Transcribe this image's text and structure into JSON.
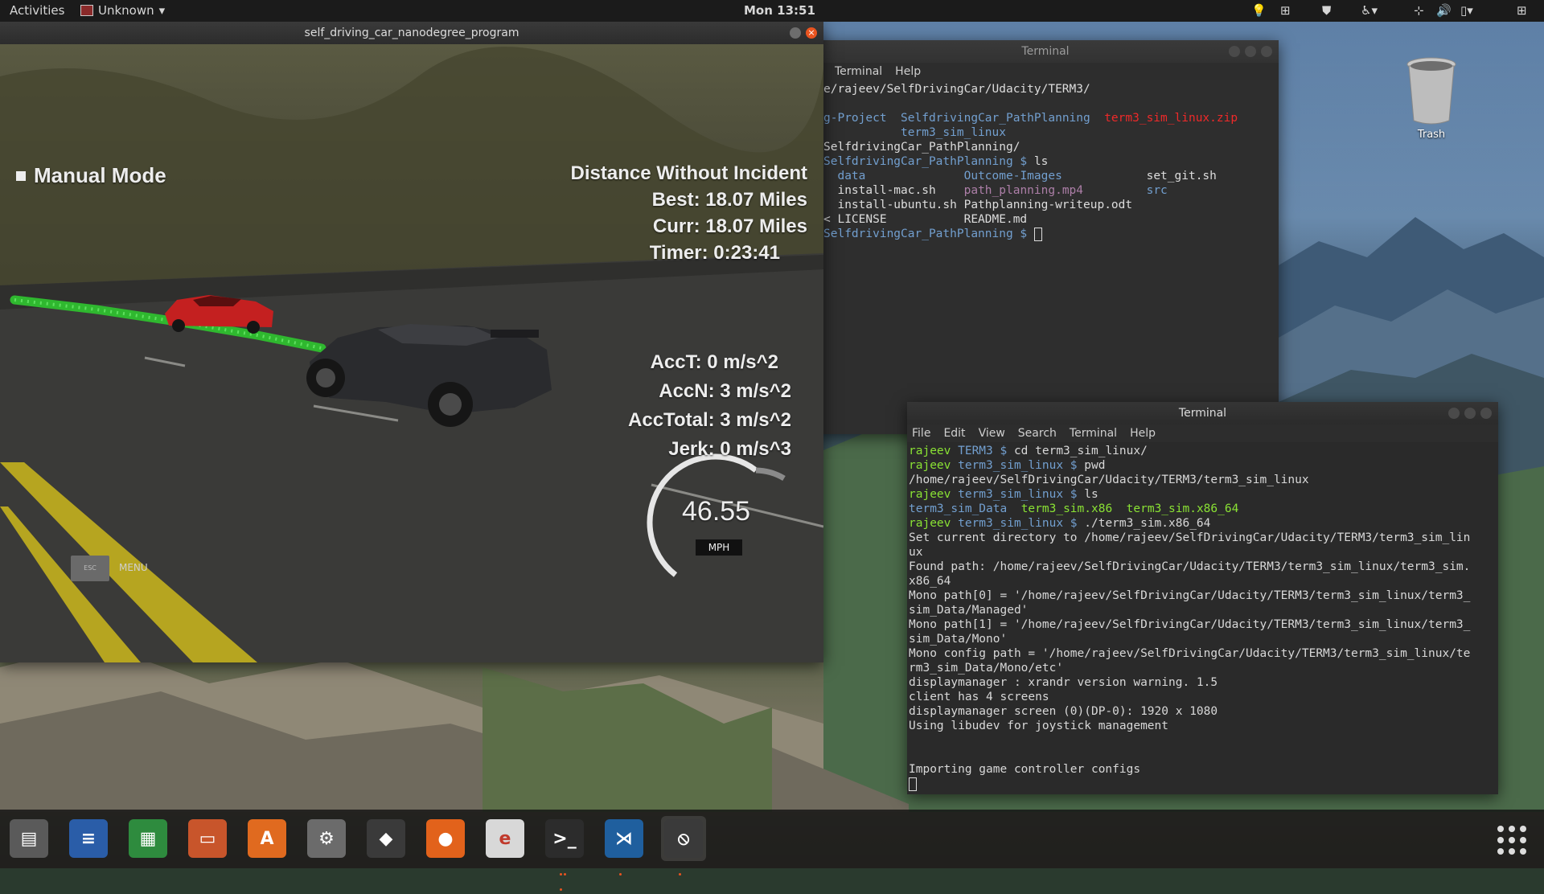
{
  "topbar": {
    "activities": "Activities",
    "app_name": "Unknown",
    "clock": "Mon 13:51"
  },
  "desktop": {
    "trash_label": "Trash"
  },
  "simulator": {
    "title": "self_driving_car_nanodegree_program",
    "mode_label": "Manual Mode",
    "distance_title": "Distance Without Incident",
    "best": "Best: 18.07 Miles",
    "curr": "Curr: 18.07 Miles",
    "timer": "Timer: 0:23:41",
    "acct": "AccT: 0 m/s^2",
    "accn": "AccN: 3 m/s^2",
    "acctotal": "AccTotal: 3 m/s^2",
    "jerk": "Jerk: 0 m/s^3",
    "speed": "46.55",
    "speed_unit": "MPH",
    "esc_label": "ESC",
    "menu_label": "MENU"
  },
  "terminal_back": {
    "title": "Terminal",
    "menu": [
      "Terminal",
      "Help"
    ],
    "lines": [
      {
        "segments": [
          {
            "text": "e/rajeev/SelfDrivingCar/Udacity/TERM3/",
            "color": ""
          }
        ]
      },
      {
        "segments": [
          {
            "text": "",
            "color": ""
          }
        ]
      },
      {
        "segments": [
          {
            "text": "g-Project  ",
            "color": "blue"
          },
          {
            "text": "SelfdrivingCar_PathPlanning  ",
            "color": "blue"
          },
          {
            "text": "term3_sim_linux.zip",
            "color": "red"
          }
        ]
      },
      {
        "segments": [
          {
            "text": "           ",
            "color": ""
          },
          {
            "text": "term3_sim_linux",
            "color": "blue"
          }
        ]
      },
      {
        "segments": [
          {
            "text": "SelfdrivingCar_PathPlanning/",
            "color": ""
          }
        ]
      },
      {
        "segments": [
          {
            "text": "SelfdrivingCar_PathPlanning $ ",
            "color": "blue"
          },
          {
            "text": "ls",
            "color": ""
          }
        ]
      },
      {
        "segments": [
          {
            "text": "  data",
            "color": "blue"
          },
          {
            "text": "              ",
            "color": ""
          },
          {
            "text": "Outcome-Images",
            "color": "blue"
          },
          {
            "text": "            set_git.sh",
            "color": ""
          }
        ]
      },
      {
        "segments": [
          {
            "text": "  install-mac.sh    ",
            "color": ""
          },
          {
            "text": "path_planning.mp4",
            "color": "mag"
          },
          {
            "text": "         ",
            "color": ""
          },
          {
            "text": "src",
            "color": "blue"
          }
        ]
      },
      {
        "segments": [
          {
            "text": "  install-ubuntu.sh Pathplanning-writeup.odt",
            "color": ""
          }
        ]
      },
      {
        "segments": [
          {
            "text": "< LICENSE           README.md",
            "color": ""
          }
        ]
      },
      {
        "segments": [
          {
            "text": "SelfdrivingCar_PathPlanning $ ",
            "color": "blue"
          },
          {
            "text": "",
            "color": "cursor"
          }
        ]
      }
    ]
  },
  "terminal_front": {
    "title": "Terminal",
    "menu": [
      "File",
      "Edit",
      "View",
      "Search",
      "Terminal",
      "Help"
    ],
    "lines": [
      {
        "segments": [
          {
            "text": "rajeev ",
            "color": "green"
          },
          {
            "text": "TERM3 $ ",
            "color": "blue"
          },
          {
            "text": "cd term3_sim_linux/",
            "color": ""
          }
        ]
      },
      {
        "segments": [
          {
            "text": "rajeev ",
            "color": "green"
          },
          {
            "text": "term3_sim_linux $ ",
            "color": "blue"
          },
          {
            "text": "pwd",
            "color": ""
          }
        ]
      },
      {
        "segments": [
          {
            "text": "/home/rajeev/SelfDrivingCar/Udacity/TERM3/term3_sim_linux",
            "color": ""
          }
        ]
      },
      {
        "segments": [
          {
            "text": "rajeev ",
            "color": "green"
          },
          {
            "text": "term3_sim_linux $ ",
            "color": "blue"
          },
          {
            "text": "ls",
            "color": ""
          }
        ]
      },
      {
        "segments": [
          {
            "text": "term3_sim_Data",
            "color": "blue"
          },
          {
            "text": "  ",
            "color": ""
          },
          {
            "text": "term3_sim.x86",
            "color": "green"
          },
          {
            "text": "  ",
            "color": ""
          },
          {
            "text": "term3_sim.x86_64",
            "color": "green"
          }
        ]
      },
      {
        "segments": [
          {
            "text": "rajeev ",
            "color": "green"
          },
          {
            "text": "term3_sim_linux $ ",
            "color": "blue"
          },
          {
            "text": "./term3_sim.x86_64",
            "color": ""
          }
        ]
      },
      {
        "segments": [
          {
            "text": "Set current directory to /home/rajeev/SelfDrivingCar/Udacity/TERM3/term3_sim_lin",
            "color": ""
          }
        ]
      },
      {
        "segments": [
          {
            "text": "ux",
            "color": ""
          }
        ]
      },
      {
        "segments": [
          {
            "text": "Found path: /home/rajeev/SelfDrivingCar/Udacity/TERM3/term3_sim_linux/term3_sim.",
            "color": ""
          }
        ]
      },
      {
        "segments": [
          {
            "text": "x86_64",
            "color": ""
          }
        ]
      },
      {
        "segments": [
          {
            "text": "Mono path[0] = '/home/rajeev/SelfDrivingCar/Udacity/TERM3/term3_sim_linux/term3_",
            "color": ""
          }
        ]
      },
      {
        "segments": [
          {
            "text": "sim_Data/Managed'",
            "color": ""
          }
        ]
      },
      {
        "segments": [
          {
            "text": "Mono path[1] = '/home/rajeev/SelfDrivingCar/Udacity/TERM3/term3_sim_linux/term3_",
            "color": ""
          }
        ]
      },
      {
        "segments": [
          {
            "text": "sim_Data/Mono'",
            "color": ""
          }
        ]
      },
      {
        "segments": [
          {
            "text": "Mono config path = '/home/rajeev/SelfDrivingCar/Udacity/TERM3/term3_sim_linux/te",
            "color": ""
          }
        ]
      },
      {
        "segments": [
          {
            "text": "rm3_sim_Data/Mono/etc'",
            "color": ""
          }
        ]
      },
      {
        "segments": [
          {
            "text": "displaymanager : xrandr version warning. 1.5",
            "color": ""
          }
        ]
      },
      {
        "segments": [
          {
            "text": "client has 4 screens",
            "color": ""
          }
        ]
      },
      {
        "segments": [
          {
            "text": "displaymanager screen (0)(DP-0): 1920 x 1080",
            "color": ""
          }
        ]
      },
      {
        "segments": [
          {
            "text": "Using libudev for joystick management",
            "color": ""
          }
        ]
      },
      {
        "segments": [
          {
            "text": "",
            "color": ""
          }
        ]
      },
      {
        "segments": [
          {
            "text": "",
            "color": ""
          }
        ]
      },
      {
        "segments": [
          {
            "text": "Importing game controller configs",
            "color": ""
          }
        ]
      },
      {
        "segments": [
          {
            "text": "",
            "color": "cursor"
          }
        ]
      }
    ]
  },
  "dock": {
    "items": [
      {
        "name": "files-icon",
        "color": "#5a5a5a",
        "glyph": "▤"
      },
      {
        "name": "writer-icon",
        "color": "#2a5da8",
        "glyph": "≡"
      },
      {
        "name": "calc-icon",
        "color": "#2e8b3e",
        "glyph": "▦"
      },
      {
        "name": "impress-icon",
        "color": "#c8552b",
        "glyph": "▭"
      },
      {
        "name": "software-center-icon",
        "color": "#e06a1f",
        "glyph": "A"
      },
      {
        "name": "settings-icon",
        "color": "#6b6b6b",
        "glyph": "⚙"
      },
      {
        "name": "sublime-icon",
        "color": "#3a3a3a",
        "glyph": "◆"
      },
      {
        "name": "firefox-icon",
        "color": "#e2621b",
        "glyph": "●"
      },
      {
        "name": "pdf-reader-icon",
        "color": "#d8d8d8",
        "glyph": "e"
      },
      {
        "name": "terminal-icon",
        "color": "#2c2c2c",
        "glyph": ">_"
      },
      {
        "name": "vscode-icon",
        "color": "#1f5f9e",
        "glyph": "⋊"
      },
      {
        "name": "simulator-icon",
        "color": "#3a3a3a",
        "glyph": "⦸"
      }
    ],
    "apps_grid_icon": "apps-grid-icon"
  }
}
